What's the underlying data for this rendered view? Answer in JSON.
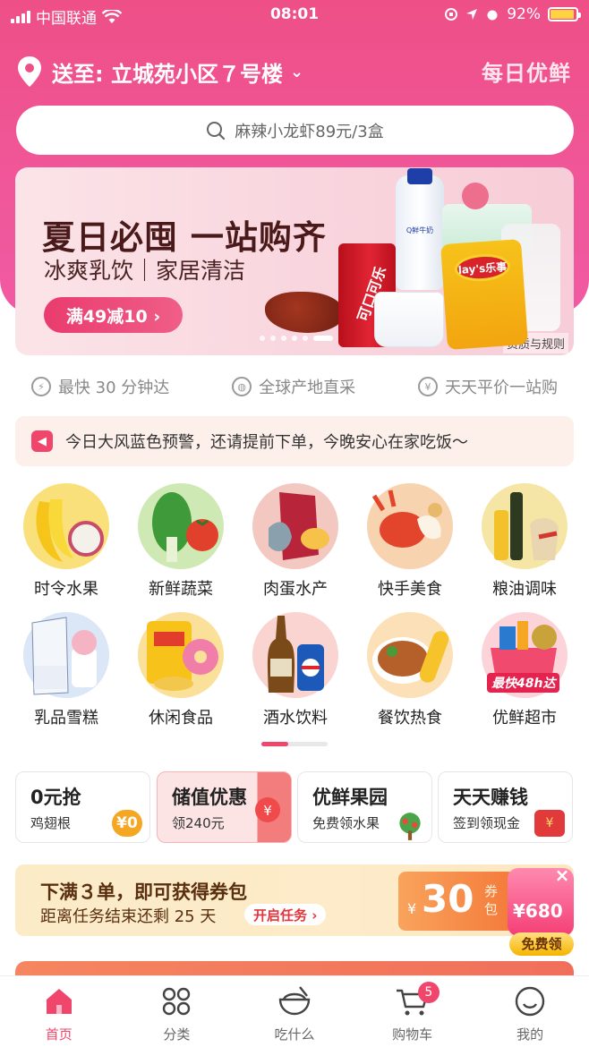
{
  "status_bar": {
    "carrier": "中国联通",
    "time": "08:01",
    "battery": "92%"
  },
  "header": {
    "address": "送至: 立城苑小区７号楼",
    "brand": "每日优鲜"
  },
  "search": {
    "placeholder": "麻辣小龙虾89元/3盒"
  },
  "banner": {
    "title": "夏日必囤 一站购齐",
    "subtitle": "冰爽乳饮｜家居清洁",
    "coupon": "满49减10 ›",
    "rules": "资质与规则",
    "coke_text": "可口可乐",
    "lays_text": "lay's乐事",
    "milk_text": "Q鲜牛奶"
  },
  "features": [
    {
      "icon": "lightning-icon",
      "label": "最快 30 分钟达"
    },
    {
      "icon": "globe-icon",
      "label": "全球产地直采"
    },
    {
      "icon": "yen-icon",
      "label": "天天平价一站购"
    }
  ],
  "notice": {
    "text": "今日大风蓝色预警，还请提前下单，今晚安心在家吃饭～"
  },
  "categories": [
    {
      "label": "时令水果",
      "icon": "fruit-icon",
      "color": "#f9e07a"
    },
    {
      "label": "新鲜蔬菜",
      "icon": "vegetable-icon",
      "color": "#cfe9b4"
    },
    {
      "label": "肉蛋水产",
      "icon": "meat-icon",
      "color": "#f2c8c0"
    },
    {
      "label": "快手美食",
      "icon": "crayfish-icon",
      "color": "#f7d3b0"
    },
    {
      "label": "粮油调味",
      "icon": "oil-icon",
      "color": "#f6e6a6"
    },
    {
      "label": "乳品雪糕",
      "icon": "milk-icon",
      "color": "#dbe6f6"
    },
    {
      "label": "休闲食品",
      "icon": "snack-icon",
      "color": "#fbe09a"
    },
    {
      "label": "酒水饮料",
      "icon": "drink-icon",
      "color": "#f9d4d0"
    },
    {
      "label": "餐饮热食",
      "icon": "hot-food-icon",
      "color": "#fbe0b8"
    },
    {
      "label": "优鲜超市",
      "icon": "supermarket-icon",
      "color": "#fbd3d8"
    }
  ],
  "category_extra": {
    "badge": "最快48h达"
  },
  "promos": [
    {
      "title": "0元抢",
      "subtitle": "鸡翅根",
      "badge": "¥0"
    },
    {
      "title": "储值优惠",
      "subtitle": "领240元",
      "badge": "¥"
    },
    {
      "title": "优鲜果园",
      "subtitle": "免费领水果",
      "badge": ""
    },
    {
      "title": "天天赚钱",
      "subtitle": "签到领现金",
      "badge": "¥"
    }
  ],
  "task": {
    "title": "下满３单，即可获得券包",
    "subtitle": "距离任务结束还剩 25 天",
    "button": "开启任务 ›",
    "ticket_yen": "¥",
    "ticket_amount": "30",
    "ticket_unit": "券包",
    "gift_amount": "¥680",
    "gift_label": "免费领",
    "close": "×"
  },
  "tabs": [
    {
      "label": "首页",
      "icon": "home-icon"
    },
    {
      "label": "分类",
      "icon": "grid-icon"
    },
    {
      "label": "吃什么",
      "icon": "bowl-icon"
    },
    {
      "label": "购物车",
      "icon": "cart-icon",
      "count": "5"
    },
    {
      "label": "我的",
      "icon": "smile-icon"
    }
  ],
  "colors": {
    "brand": "#f0466c",
    "header": "#ee4f86"
  }
}
